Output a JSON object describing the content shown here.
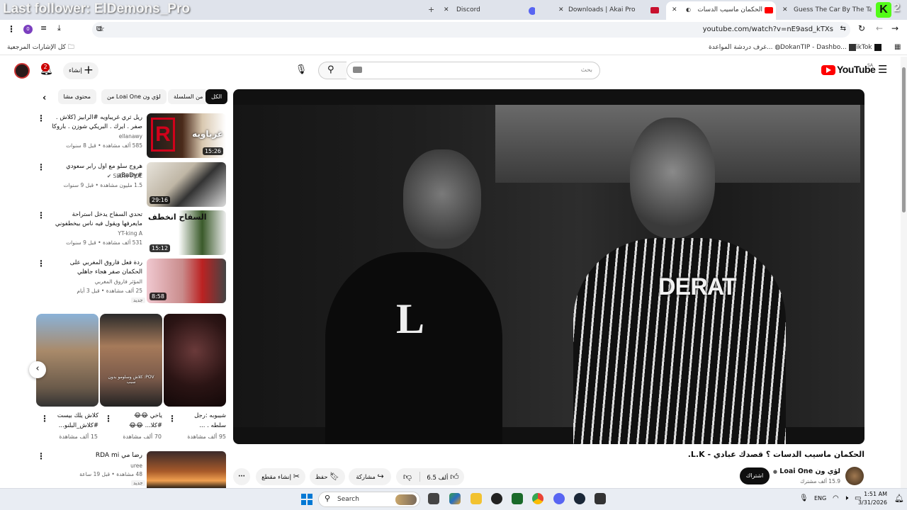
{
  "stream_overlay": "Last follower: ElDemons_Pro",
  "tabs": [
    {
      "label": "Discord"
    },
    {
      "label": "Downloads | Akai Pro"
    },
    {
      "label": "الحكمان ماسيب الدسات ؟ قصد"
    },
    {
      "label": "Guess The Car By The Tail Light"
    }
  ],
  "profile_badge": "0",
  "url": "youtube.com/watch?v=nE9asd_kTXs",
  "bookmarks": {
    "all": "كل الإشارات المرجعية",
    "items": [
      "غرف دردشة المواعدة...",
      "DokanTIP - Dashbo...",
      "TikTok"
    ]
  },
  "header": {
    "logo": "YouTube",
    "region": "SA",
    "search_placeholder": "بحث",
    "create_label": "إنشاء",
    "notifications": "2"
  },
  "chips": [
    "الكل",
    "من السلسلة",
    "من Loai One لؤي ون",
    "محتوى مشا"
  ],
  "videos": [
    {
      "title": "ريل ثري غريباويه #الرابيز (كلاش . صفر . ايرك . البريكي شوزن . باروكا . ستيف . ...",
      "channel": "ellanawy",
      "meta": "585 ألف مشاهدة • قبل 8 سنوات",
      "duration": "15:26",
      "thumb_text": "غرباويه"
    },
    {
      "title": "هروج سلو مع اول رابر سعودي #aBaDy",
      "channel": "SLOW MOE",
      "meta": "1.5 مليون مشاهدة • قبل 9 سنوات",
      "duration": "29:16",
      "thumb_text": ""
    },
    {
      "title": "تحدي السفاح يدخل استراحة مايعرفها ويقول فيه ناس بيخطفوني #اقوى_قحه",
      "channel": "YT-king A",
      "meta": "531 ألف مشاهدة • قبل 9 سنوات",
      "duration": "15:12",
      "thumb_text": "السفاح انخطف"
    },
    {
      "title": "ردة فعل فاروق المغربي على الحكمان صفر هجاء جاهلي",
      "channel": "المؤثر فاروق المغربي",
      "meta": "25 ألف مشاهدة • قبل 3 أيام",
      "duration": "8:58",
      "badge": "جديد",
      "thumb_text": ""
    }
  ],
  "shorts": [
    {
      "title": "شيبوبه :رجل سلطه . ...",
      "views": "95 ألف مشاهدة"
    },
    {
      "title": "ياخي 😂😂 #كلا... 😂😂",
      "views": "70 ألف مشاهدة"
    },
    {
      "title": "كلاش يلك بيست #كلاش_البلنو...",
      "views": "15 ألف مشاهدة"
    }
  ],
  "shorts_overlay": "POV: كلاش وسلومو بدون سبب",
  "last_video": {
    "title": "رضا مي RDA mi",
    "channel": "uree",
    "meta": "48 مشاهدة • قبل 19 ساعة",
    "badge": "جديد"
  },
  "main_video": {
    "title": "الحكمان ماسيب الدسات ؟ قصدك عبادي - L.K.",
    "channel": "لؤي ون Loai One",
    "subscribers": "15.9 ألف مشترك",
    "subscribe_label": "اشتراك",
    "likes": "6.5 ألف",
    "share_label": "مشاركة",
    "save_label": "حفظ",
    "clip_label": "إنشاء مقطع",
    "shirt_text": "DERAT"
  },
  "taskbar": {
    "search": "Search",
    "lang": "ENG",
    "time": "1:51 AM",
    "date": "3/31/2026"
  },
  "colors": {
    "youtube_red": "#ff0000",
    "tabbar": "#dfe3eb",
    "taskbar": "#e9edf3"
  }
}
